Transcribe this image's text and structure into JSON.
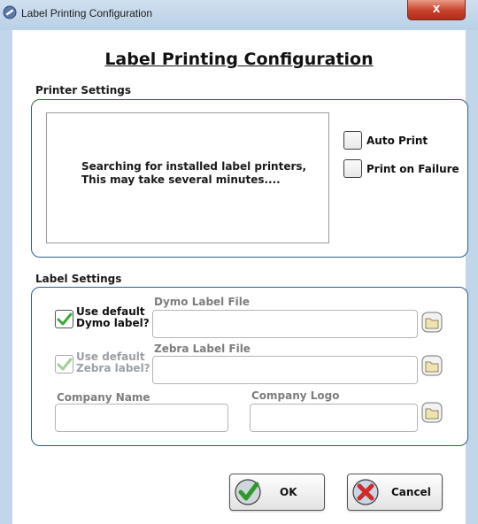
{
  "window": {
    "title": "Label Printing Configuration",
    "close_glyph": "x"
  },
  "form": {
    "heading": "Label Printing Configuration"
  },
  "printer_settings": {
    "section_label": "Printer Settings",
    "status_line1": "Searching for installed label printers,",
    "status_line2": "This may take several minutes....",
    "auto_print_label": "Auto Print",
    "auto_print_checked": false,
    "print_on_failure_label": "Print on Failure",
    "print_on_failure_checked": false
  },
  "label_settings": {
    "section_label": "Label Settings",
    "dymo_default": {
      "line1": "Use default",
      "line2": "Dymo label?",
      "checked": true,
      "enabled": true
    },
    "dymo_file": {
      "label": "Dymo Label File",
      "value": ""
    },
    "zebra_default": {
      "line1": "Use default",
      "line2": "Zebra label?",
      "checked": true,
      "enabled": false
    },
    "zebra_file": {
      "label": "Zebra Label File",
      "value": ""
    },
    "company_name": {
      "label": "Company Name",
      "value": ""
    },
    "company_logo": {
      "label": "Company Logo",
      "value": ""
    }
  },
  "buttons": {
    "ok_label": "OK",
    "cancel_label": "Cancel"
  },
  "icons": {
    "window_icon": "no-entry-icon",
    "browse_icon": "folder-icon",
    "ok_icon": "green-check-icon",
    "cancel_icon": "red-x-icon"
  }
}
